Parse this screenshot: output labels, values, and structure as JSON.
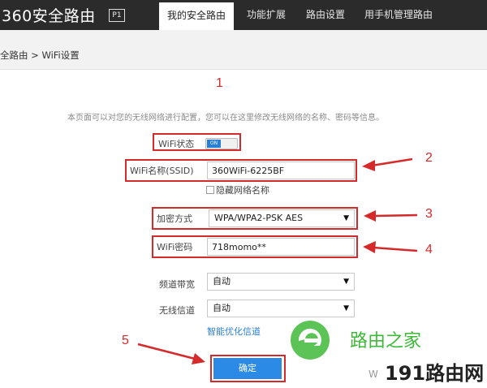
{
  "header": {
    "logo": "360安全路由",
    "badge": "P1",
    "nav": [
      "我的安全路由",
      "功能扩展",
      "路由设置",
      "用手机管理路由"
    ]
  },
  "breadcrumb": "全路由 > WiFi设置",
  "description": "本页面可以对您的无线网络进行配置，您可以在这里修改无线网络的名称、密码等信息。",
  "form": {
    "wifi_status_label": "WiFi状态",
    "wifi_status_value": "ON",
    "ssid_label": "WiFi名称(SSID)",
    "ssid_value": "360WiFi-6225BF",
    "hide_label": "隐藏网络名称",
    "encrypt_label": "加密方式",
    "encrypt_value": "WPA/WPA2-PSK AES",
    "password_label": "WiFi密码",
    "password_value": "718momo**",
    "bandwidth_label": "频道带宽",
    "bandwidth_value": "自动",
    "channel_label": "无线信道",
    "channel_value": "自动",
    "optimize_link": "智能优化信道",
    "submit_label": "确定"
  },
  "annotations": [
    "1",
    "2",
    "3",
    "4",
    "5"
  ],
  "watermark": {
    "brand": "路由之家",
    "site": "191路由网",
    "letter": "W"
  },
  "colors": {
    "topbar": "#2b2b2b",
    "annotation_red": "#d52a2a",
    "primary_blue": "#2b8ae6",
    "watermark_green": "#3fb93a"
  }
}
